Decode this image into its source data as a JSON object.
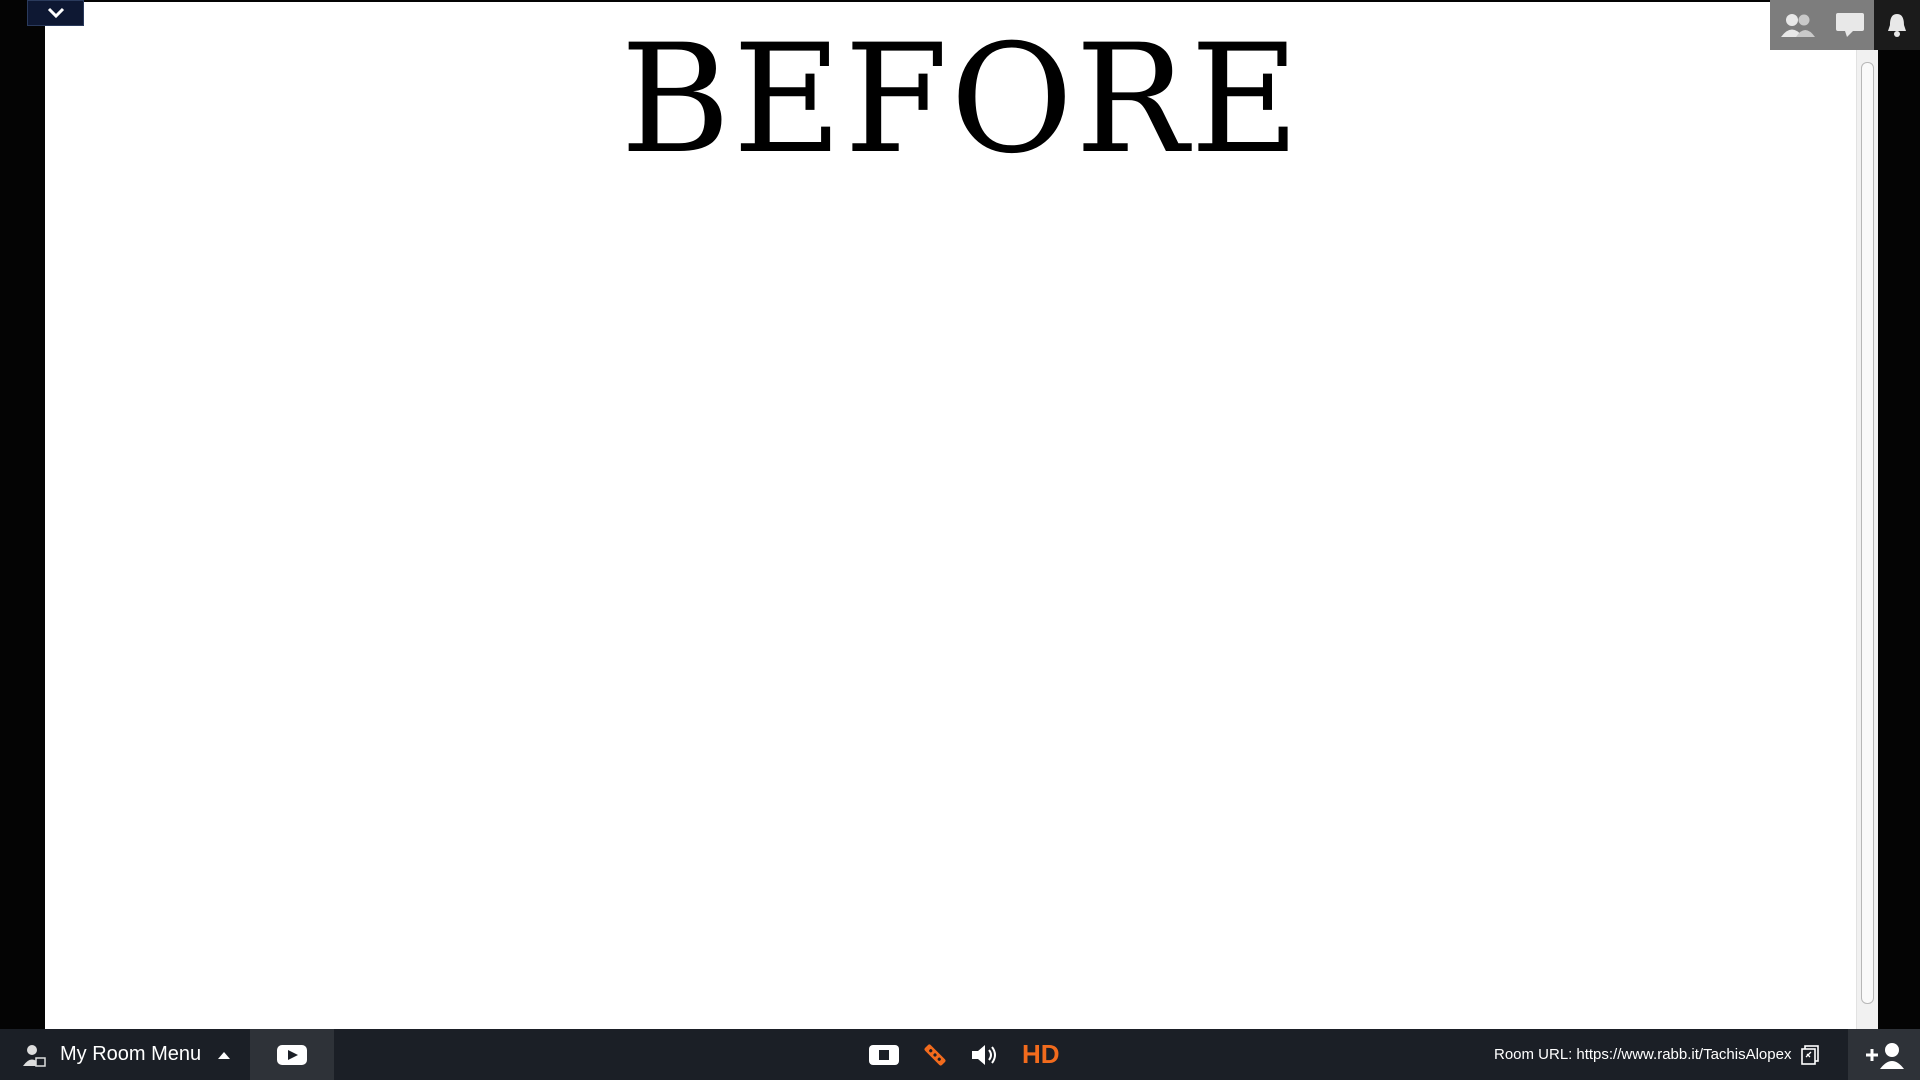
{
  "document": {
    "heading": "BEFORE"
  },
  "top_right": {
    "icons": [
      "people-icon",
      "chat-icon",
      "bell-icon"
    ]
  },
  "bottom_bar": {
    "room_menu_label": "My Room Menu",
    "room_url_label": "Room URL:",
    "room_url": "https://www.rabb.it/TachisAlopex",
    "quality_label": "HD"
  },
  "colors": {
    "accent": "#f26b1d",
    "bar_background": "#1b1f26",
    "collapse_button": "#0e1833"
  }
}
